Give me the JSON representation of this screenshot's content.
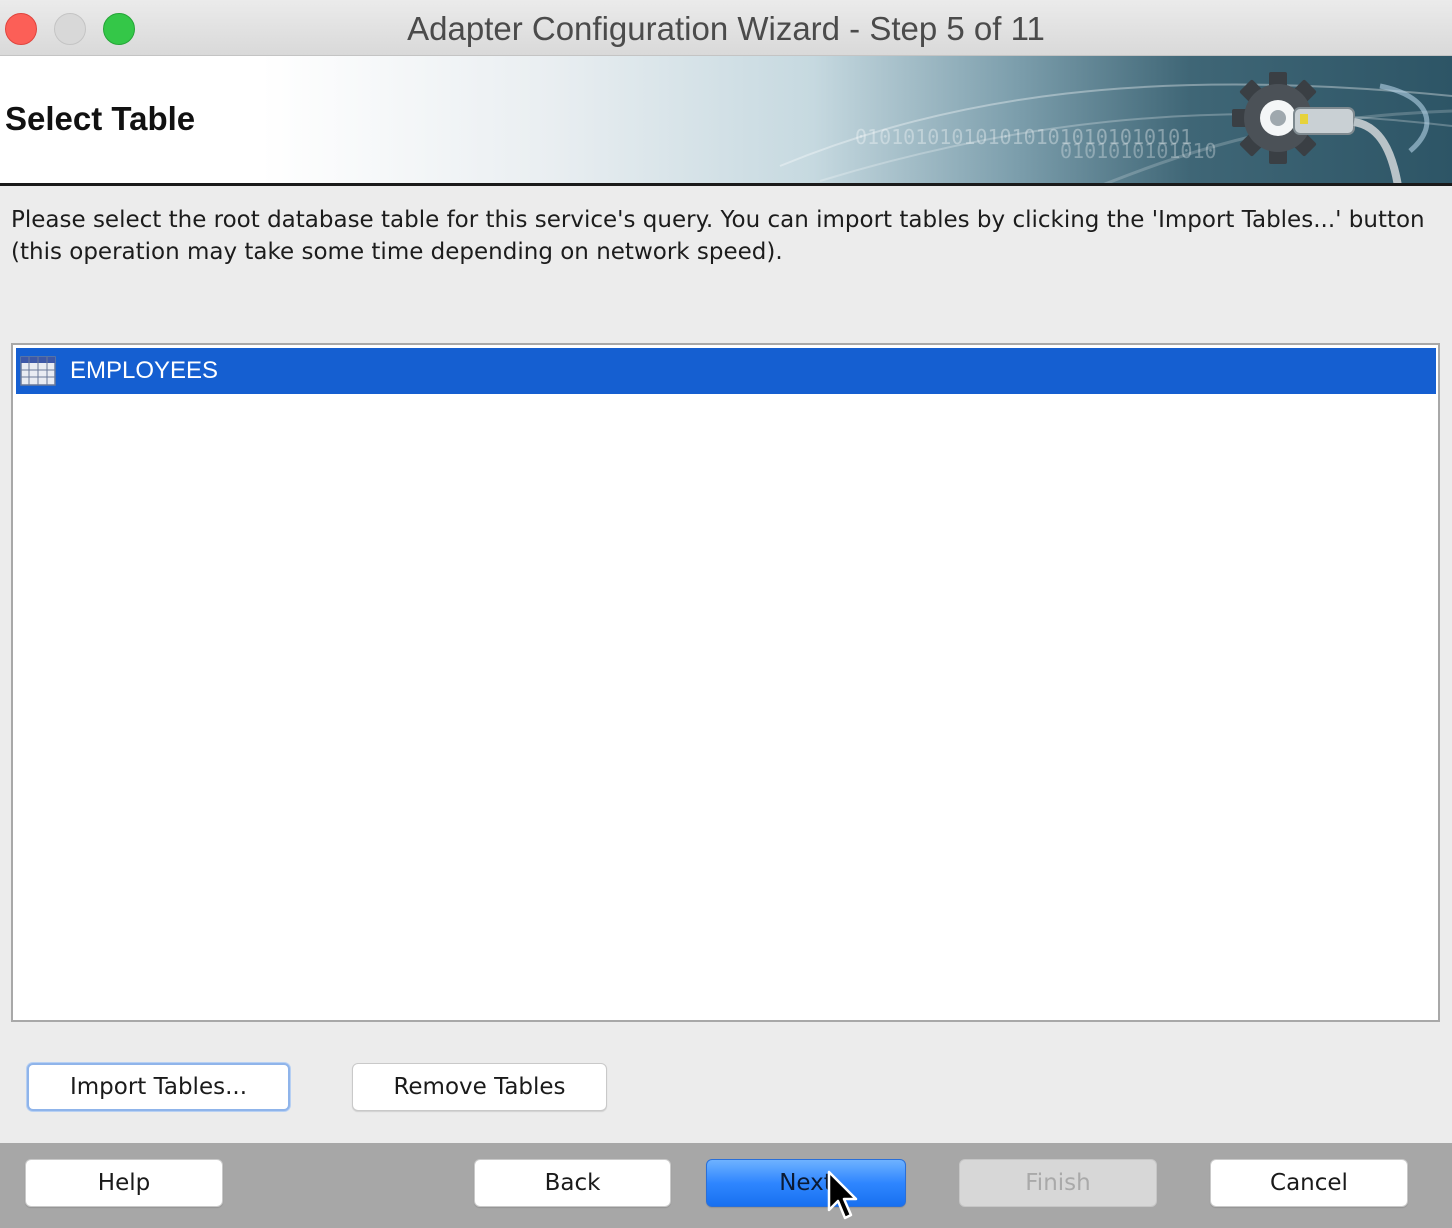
{
  "window": {
    "title": "Adapter Configuration Wizard - Step 5 of 11"
  },
  "header": {
    "title": "Select Table",
    "banner_binary_line1": "0101010101010101010101010101",
    "banner_binary_line2": "0101010101010"
  },
  "description": "Please select the root database table for this service's query.  You can import tables by clicking the 'Import Tables...' button (this operation may take some time depending on network speed).",
  "tables": {
    "items": [
      {
        "label": "EMPLOYEES",
        "selected": true,
        "icon": "table-grid-icon"
      }
    ]
  },
  "table_actions": {
    "import_label": "Import Tables...",
    "remove_label": "Remove Tables"
  },
  "footer": {
    "help_label": "Help",
    "back_label": "Back",
    "next_label": "Next",
    "finish_label": "Finish",
    "cancel_label": "Cancel"
  },
  "colors": {
    "selection": "#155fd1",
    "primary_button": "#2f86ff",
    "footer_bg": "#a7a7a7"
  }
}
